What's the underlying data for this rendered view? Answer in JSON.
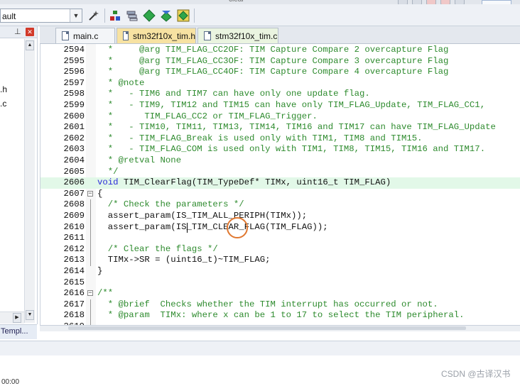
{
  "toolbar": {
    "target_value": "ault",
    "top_strip_text": "clear",
    "icons": [
      "dropdown-arrow",
      "options-wand-icon",
      "manage-components-icon",
      "stack-icon",
      "diamond-green-icon",
      "diamond-arrow-icon",
      "build-grid-icon"
    ]
  },
  "left_panel": {
    "items": [
      ".h",
      ".c"
    ],
    "tab_label": "Templ..."
  },
  "tabs": [
    {
      "label": "main.c",
      "state": "inactive"
    },
    {
      "label": "stm32f10x_tim.h",
      "state": "mid"
    },
    {
      "label": "stm32f10x_tim.c",
      "state": "active"
    }
  ],
  "editor": {
    "lines": [
      {
        "n": "2594",
        "fold": "",
        "cls": "c-com",
        "text": "  *     @arg TIM_FLAG_CC2OF: TIM Capture Compare 2 overcapture Flag"
      },
      {
        "n": "2595",
        "fold": "",
        "cls": "c-com",
        "text": "  *     @arg TIM_FLAG_CC3OF: TIM Capture Compare 3 overcapture Flag"
      },
      {
        "n": "2596",
        "fold": "",
        "cls": "c-com",
        "text": "  *     @arg TIM_FLAG_CC4OF: TIM Capture Compare 4 overcapture Flag"
      },
      {
        "n": "2597",
        "fold": "",
        "cls": "c-com",
        "text": "  * @note"
      },
      {
        "n": "2598",
        "fold": "",
        "cls": "c-com",
        "text": "  *   - TIM6 and TIM7 can have only one update flag."
      },
      {
        "n": "2599",
        "fold": "",
        "cls": "c-com",
        "text": "  *   - TIM9, TIM12 and TIM15 can have only TIM_FLAG_Update, TIM_FLAG_CC1,"
      },
      {
        "n": "2600",
        "fold": "",
        "cls": "c-com",
        "text": "  *      TIM_FLAG_CC2 or TIM_FLAG_Trigger."
      },
      {
        "n": "2601",
        "fold": "",
        "cls": "c-com",
        "text": "  *   - TIM10, TIM11, TIM13, TIM14, TIM16 and TIM17 can have TIM_FLAG_Update"
      },
      {
        "n": "2602",
        "fold": "",
        "cls": "c-com",
        "text": "  *   - TIM_FLAG_Break is used only with TIM1, TIM8 and TIM15."
      },
      {
        "n": "2603",
        "fold": "",
        "cls": "c-com",
        "text": "  *   - TIM_FLAG_COM is used only with TIM1, TIM8, TIM15, TIM16 and TIM17."
      },
      {
        "n": "2604",
        "fold": "",
        "cls": "c-com",
        "text": "  * @retval None"
      },
      {
        "n": "2605",
        "fold": "",
        "cls": "c-com",
        "text": "  */"
      },
      {
        "n": "2606",
        "fold": "",
        "cls": "mixed",
        "kw": "void",
        "text": " TIM_ClearFlag(TIM_TypeDef* TIMx, uint16_t TIM_FLAG)"
      },
      {
        "n": "2607",
        "fold": "minus",
        "cls": "c-txt",
        "text": "{"
      },
      {
        "n": "2608",
        "fold": "",
        "cls": "c-com",
        "text": "  /* Check the parameters */"
      },
      {
        "n": "2609",
        "fold": "",
        "cls": "c-txt",
        "text": "  assert_param(IS_TIM_ALL_PERIPH(TIMx));"
      },
      {
        "n": "2610",
        "fold": "",
        "cls": "c-txt",
        "text": "  assert_param(IS_TIM_CLEAR_FLAG(TIM_FLAG));"
      },
      {
        "n": "2611",
        "fold": "",
        "cls": "c-txt",
        "text": ""
      },
      {
        "n": "2612",
        "fold": "",
        "cls": "c-com",
        "text": "  /* Clear the flags */"
      },
      {
        "n": "2613",
        "fold": "",
        "cls": "c-txt",
        "text": "  TIMx->SR = (uint16_t)~TIM_FLAG;"
      },
      {
        "n": "2614",
        "fold": "",
        "cls": "c-txt",
        "text": "}"
      },
      {
        "n": "2615",
        "fold": "",
        "cls": "c-txt",
        "text": ""
      },
      {
        "n": "2616",
        "fold": "minus",
        "cls": "c-com",
        "text": "/**"
      },
      {
        "n": "2617",
        "fold": "",
        "cls": "c-com",
        "text": "  * @brief  Checks whether the TIM interrupt has occurred or not."
      },
      {
        "n": "2618",
        "fold": "",
        "cls": "c-com",
        "text": "  * @param  TIMx: where x can be 1 to 17 to select the TIM peripheral."
      },
      {
        "n": "2619",
        "fold": "",
        "cls": "c-com",
        "text": ""
      }
    ],
    "highlight_line": "2606"
  },
  "status": {
    "bottom_text": "00:00"
  },
  "watermark": "CSDN @古译汉书",
  "colors": {
    "comment": "#2e8b2e",
    "keyword": "#2b2bd9",
    "highlight": "#e2f8e8",
    "circle": "#e07830"
  }
}
